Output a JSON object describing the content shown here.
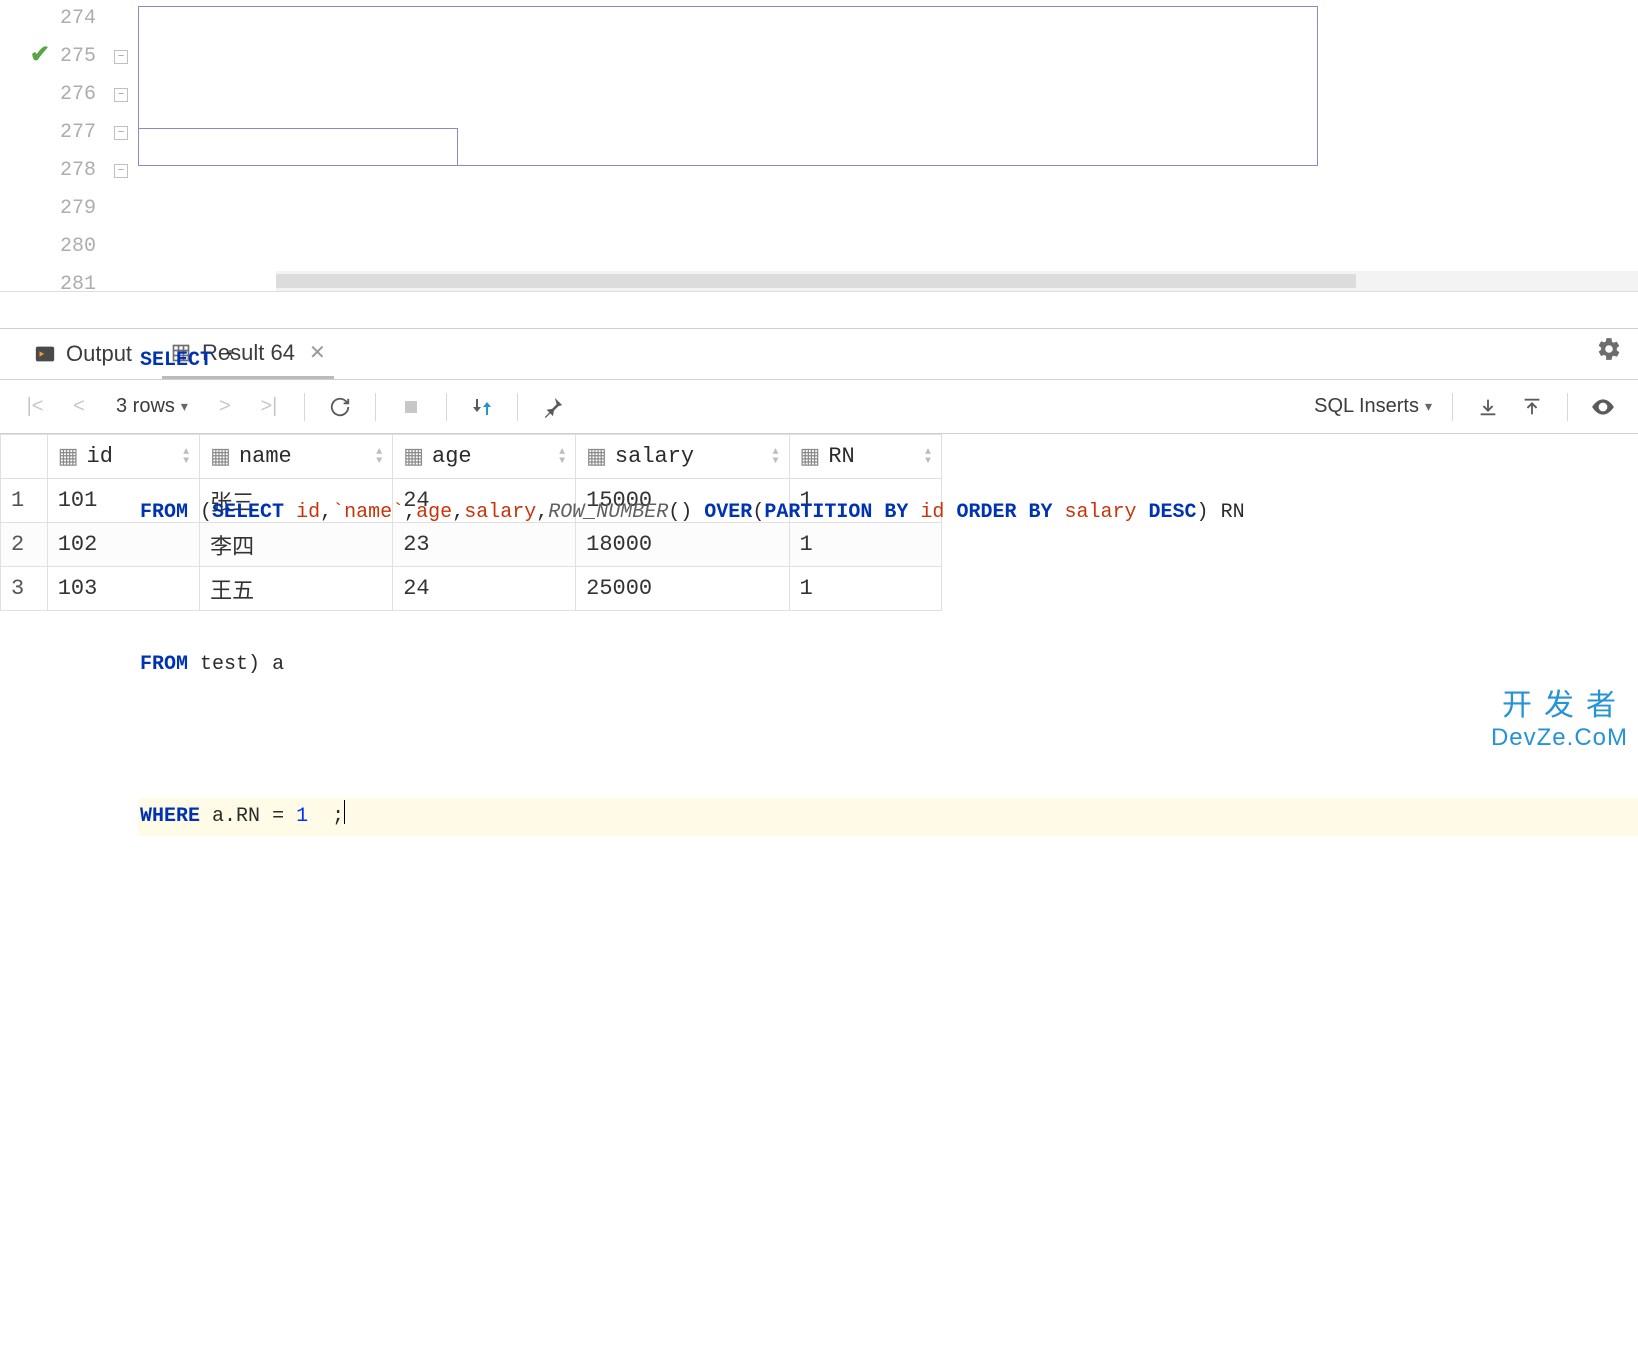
{
  "editor": {
    "line_numbers": [
      "274",
      "275",
      "276",
      "277",
      "278",
      "279",
      "280",
      "281"
    ],
    "run_indicator_line": "275",
    "tokens": {
      "l275": {
        "select": "SELECT",
        "star": "*"
      },
      "l276": {
        "from": "FROM",
        "lp": "(",
        "select": "SELECT",
        "c_id": "id",
        "comma1": ",",
        "btick1": "`",
        "c_name": "name",
        "btick2": "`",
        "comma2": ",",
        "c_age": "age",
        "comma3": ",",
        "c_salary": "salary",
        "comma4": ",",
        "fn_rownum": "ROW_NUMBER",
        "paren_empty": "()",
        "over": "OVER",
        "lp2": "(",
        "part": "PARTITION",
        "by": "BY",
        "p_id": "id",
        "order": "ORDER",
        "by2": "BY",
        "o_col": "salary",
        "desc": "DESC",
        "rp2": ")",
        "alias": "RN"
      },
      "l277": {
        "from": "FROM",
        "tbl": "test",
        "rp": ")",
        "a": "a"
      },
      "l278": {
        "where": "WHERE",
        "expr_l": "a.RN",
        "eq": "=",
        "num": "1",
        "semi": ";"
      }
    }
  },
  "tabs": {
    "output": "Output",
    "result_label": "Result 64"
  },
  "toolbar": {
    "row_count": "3 rows",
    "view_mode": "SQL Inserts"
  },
  "columns": [
    {
      "name": "id",
      "numeric": false
    },
    {
      "name": "name",
      "numeric": false
    },
    {
      "name": "age",
      "numeric": false
    },
    {
      "name": "salary",
      "numeric": true
    },
    {
      "name": "RN",
      "numeric": true
    }
  ],
  "rows": [
    {
      "n": "1",
      "id": "101",
      "name": "张三",
      "age": "24",
      "salary": "15000",
      "RN": "1"
    },
    {
      "n": "2",
      "id": "102",
      "name": "李四",
      "age": "23",
      "salary": "18000",
      "RN": "1"
    },
    {
      "n": "3",
      "id": "103",
      "name": "王五",
      "age": "24",
      "salary": "25000",
      "RN": "1"
    }
  ],
  "watermark": {
    "cn": "开发者",
    "en": "DevZe.CoM"
  }
}
